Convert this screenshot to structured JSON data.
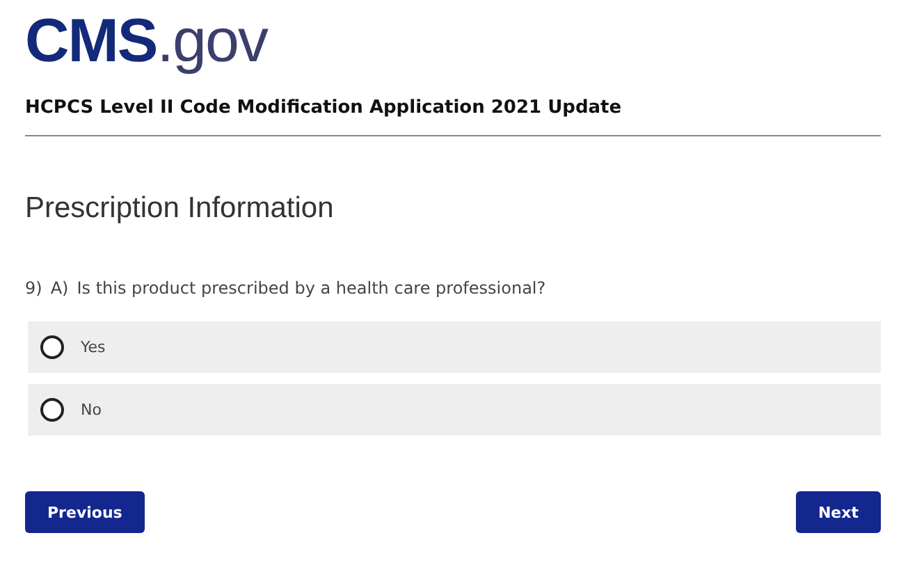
{
  "logo": {
    "strong": "CMS",
    "rest": ".gov"
  },
  "title": "HCPCS Level II Code Modification Application 2021 Update",
  "section_heading": "Prescription Information",
  "question": {
    "number": "9)",
    "part": "A)",
    "text": "Is this product prescribed by a health care professional?"
  },
  "options": [
    {
      "label": "Yes",
      "selected": false
    },
    {
      "label": "No",
      "selected": false
    }
  ],
  "buttons": {
    "previous": "Previous",
    "next": "Next"
  }
}
